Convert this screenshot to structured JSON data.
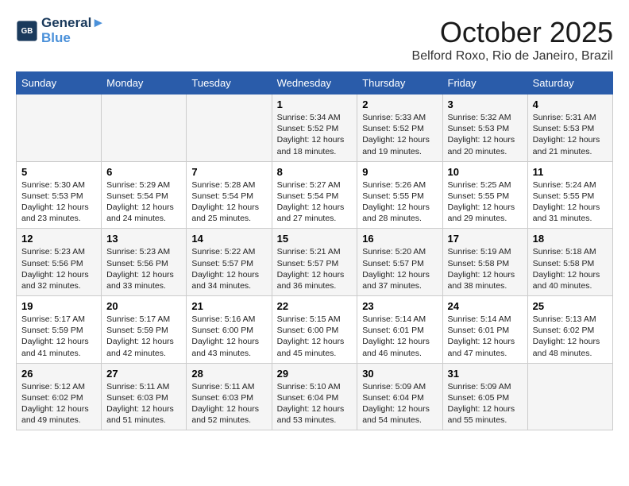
{
  "header": {
    "logo_line1": "General",
    "logo_line2": "Blue",
    "month": "October 2025",
    "location": "Belford Roxo, Rio de Janeiro, Brazil"
  },
  "days_of_week": [
    "Sunday",
    "Monday",
    "Tuesday",
    "Wednesday",
    "Thursday",
    "Friday",
    "Saturday"
  ],
  "weeks": [
    [
      {
        "day": "",
        "text": ""
      },
      {
        "day": "",
        "text": ""
      },
      {
        "day": "",
        "text": ""
      },
      {
        "day": "1",
        "text": "Sunrise: 5:34 AM\nSunset: 5:52 PM\nDaylight: 12 hours\nand 18 minutes."
      },
      {
        "day": "2",
        "text": "Sunrise: 5:33 AM\nSunset: 5:52 PM\nDaylight: 12 hours\nand 19 minutes."
      },
      {
        "day": "3",
        "text": "Sunrise: 5:32 AM\nSunset: 5:53 PM\nDaylight: 12 hours\nand 20 minutes."
      },
      {
        "day": "4",
        "text": "Sunrise: 5:31 AM\nSunset: 5:53 PM\nDaylight: 12 hours\nand 21 minutes."
      }
    ],
    [
      {
        "day": "5",
        "text": "Sunrise: 5:30 AM\nSunset: 5:53 PM\nDaylight: 12 hours\nand 23 minutes."
      },
      {
        "day": "6",
        "text": "Sunrise: 5:29 AM\nSunset: 5:54 PM\nDaylight: 12 hours\nand 24 minutes."
      },
      {
        "day": "7",
        "text": "Sunrise: 5:28 AM\nSunset: 5:54 PM\nDaylight: 12 hours\nand 25 minutes."
      },
      {
        "day": "8",
        "text": "Sunrise: 5:27 AM\nSunset: 5:54 PM\nDaylight: 12 hours\nand 27 minutes."
      },
      {
        "day": "9",
        "text": "Sunrise: 5:26 AM\nSunset: 5:55 PM\nDaylight: 12 hours\nand 28 minutes."
      },
      {
        "day": "10",
        "text": "Sunrise: 5:25 AM\nSunset: 5:55 PM\nDaylight: 12 hours\nand 29 minutes."
      },
      {
        "day": "11",
        "text": "Sunrise: 5:24 AM\nSunset: 5:55 PM\nDaylight: 12 hours\nand 31 minutes."
      }
    ],
    [
      {
        "day": "12",
        "text": "Sunrise: 5:23 AM\nSunset: 5:56 PM\nDaylight: 12 hours\nand 32 minutes."
      },
      {
        "day": "13",
        "text": "Sunrise: 5:23 AM\nSunset: 5:56 PM\nDaylight: 12 hours\nand 33 minutes."
      },
      {
        "day": "14",
        "text": "Sunrise: 5:22 AM\nSunset: 5:57 PM\nDaylight: 12 hours\nand 34 minutes."
      },
      {
        "day": "15",
        "text": "Sunrise: 5:21 AM\nSunset: 5:57 PM\nDaylight: 12 hours\nand 36 minutes."
      },
      {
        "day": "16",
        "text": "Sunrise: 5:20 AM\nSunset: 5:57 PM\nDaylight: 12 hours\nand 37 minutes."
      },
      {
        "day": "17",
        "text": "Sunrise: 5:19 AM\nSunset: 5:58 PM\nDaylight: 12 hours\nand 38 minutes."
      },
      {
        "day": "18",
        "text": "Sunrise: 5:18 AM\nSunset: 5:58 PM\nDaylight: 12 hours\nand 40 minutes."
      }
    ],
    [
      {
        "day": "19",
        "text": "Sunrise: 5:17 AM\nSunset: 5:59 PM\nDaylight: 12 hours\nand 41 minutes."
      },
      {
        "day": "20",
        "text": "Sunrise: 5:17 AM\nSunset: 5:59 PM\nDaylight: 12 hours\nand 42 minutes."
      },
      {
        "day": "21",
        "text": "Sunrise: 5:16 AM\nSunset: 6:00 PM\nDaylight: 12 hours\nand 43 minutes."
      },
      {
        "day": "22",
        "text": "Sunrise: 5:15 AM\nSunset: 6:00 PM\nDaylight: 12 hours\nand 45 minutes."
      },
      {
        "day": "23",
        "text": "Sunrise: 5:14 AM\nSunset: 6:01 PM\nDaylight: 12 hours\nand 46 minutes."
      },
      {
        "day": "24",
        "text": "Sunrise: 5:14 AM\nSunset: 6:01 PM\nDaylight: 12 hours\nand 47 minutes."
      },
      {
        "day": "25",
        "text": "Sunrise: 5:13 AM\nSunset: 6:02 PM\nDaylight: 12 hours\nand 48 minutes."
      }
    ],
    [
      {
        "day": "26",
        "text": "Sunrise: 5:12 AM\nSunset: 6:02 PM\nDaylight: 12 hours\nand 49 minutes."
      },
      {
        "day": "27",
        "text": "Sunrise: 5:11 AM\nSunset: 6:03 PM\nDaylight: 12 hours\nand 51 minutes."
      },
      {
        "day": "28",
        "text": "Sunrise: 5:11 AM\nSunset: 6:03 PM\nDaylight: 12 hours\nand 52 minutes."
      },
      {
        "day": "29",
        "text": "Sunrise: 5:10 AM\nSunset: 6:04 PM\nDaylight: 12 hours\nand 53 minutes."
      },
      {
        "day": "30",
        "text": "Sunrise: 5:09 AM\nSunset: 6:04 PM\nDaylight: 12 hours\nand 54 minutes."
      },
      {
        "day": "31",
        "text": "Sunrise: 5:09 AM\nSunset: 6:05 PM\nDaylight: 12 hours\nand 55 minutes."
      },
      {
        "day": "",
        "text": ""
      }
    ]
  ]
}
